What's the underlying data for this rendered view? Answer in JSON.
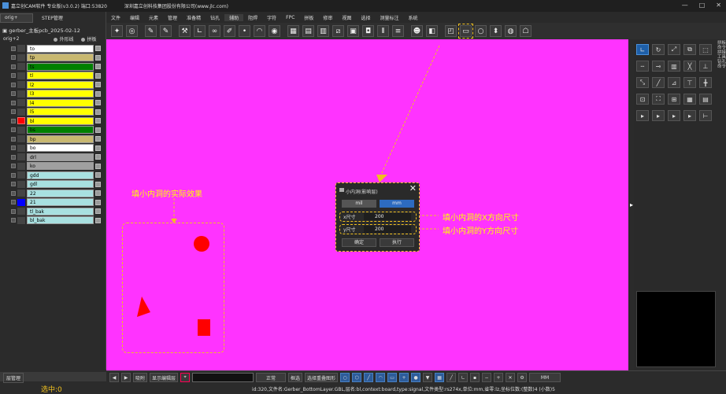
{
  "window": {
    "title": "嘉立创CAM软件 专业版(v3.0.2) 端口:53820",
    "company": "深圳嘉立创科技集团股份有限公司(www.jlc.com)",
    "min": "—",
    "max": "□",
    "close": "✕"
  },
  "menu": [
    "文件",
    "编辑",
    "元素",
    "管理",
    "准备精",
    "钻孔",
    "辅助",
    "阻焊",
    "字符",
    "FPC",
    "拼板",
    "修审",
    "视图",
    "选择",
    "测量标注",
    "系统"
  ],
  "left_tabs": {
    "orig": "orig+",
    "step": "STEP管理"
  },
  "job_name": "gerber_主板pcb_2025-02-12",
  "step_name": "orig+2",
  "options": {
    "outline": "外形线",
    "panel": "拼板"
  },
  "layers": [
    {
      "name": "to",
      "color": "#ffffff"
    },
    {
      "name": "tp",
      "color": "#c8b870"
    },
    {
      "name": "ts",
      "color": "#008000"
    },
    {
      "name": "tl",
      "color": "#ffff00"
    },
    {
      "name": "l2",
      "color": "#ffff00"
    },
    {
      "name": "l3",
      "color": "#ffff00"
    },
    {
      "name": "l4",
      "color": "#ffff00"
    },
    {
      "name": "l5",
      "color": "#ffff00"
    },
    {
      "name": "bl",
      "color": "#ffff00",
      "swatch": "#ff0000"
    },
    {
      "name": "bs",
      "color": "#008000"
    },
    {
      "name": "bp",
      "color": "#c8b870"
    },
    {
      "name": "bo",
      "color": "#ffffff"
    },
    {
      "name": "drl",
      "color": "#a0a0a0"
    },
    {
      "name": "ko",
      "color": "#a0a0a0"
    },
    {
      "name": "gdd",
      "color": "#a8e0e0"
    },
    {
      "name": "gdl",
      "color": "#a8e0e0"
    },
    {
      "name": "22",
      "color": "#a8e0e0"
    },
    {
      "name": "21",
      "color": "#a8e0e0",
      "swatch": "#0000ff"
    },
    {
      "name": "tl_bak",
      "color": "#a8e0e0"
    },
    {
      "name": "bl_bak",
      "color": "#a8e0e0"
    }
  ],
  "left_bottom": {
    "btn": "层管理",
    "selected": "选中:0"
  },
  "dialog": {
    "title": "小内洞(影响层)",
    "close": "✕",
    "unit_mil": "mil",
    "unit_mm": "mm",
    "x_label": "x尺寸",
    "x_value": "200",
    "y_label": "y尺寸",
    "y_value": "200",
    "ok": "确定",
    "exec": "执行"
  },
  "annotations": {
    "effect": "填小内洞的实际效果",
    "x_dim": "填小内洞的X方向尺寸",
    "y_dim": "填小内洞的Y方向尺寸"
  },
  "bottombar": {
    "mode": "吸附",
    "show": "显示编辑层",
    "line": "正常",
    "select": "框选",
    "mode2": "选择重叠图形",
    "unit": "MM"
  },
  "status": "id:320,文件名:Gerber_BottomLayer.GBL,层名:bl,context:board,type:signal,文件类型:rs274x,单位:mm,省零:lz,坐标位数:(整数)4 (小数)5",
  "right_sidebar": "拼板命令 拼接工具 钻孔命令"
}
